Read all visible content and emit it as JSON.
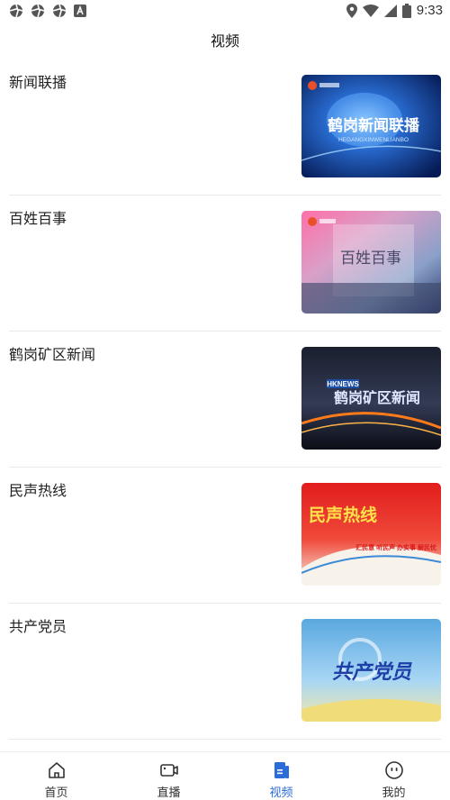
{
  "status_bar": {
    "time": "9:33",
    "left_icons": [
      "aperture-icon",
      "aperture-icon",
      "aperture-icon",
      "a-badge-icon"
    ],
    "right_icons": [
      "location-icon",
      "wifi-icon",
      "signal-icon",
      "battery-icon"
    ]
  },
  "header": {
    "title": "视频"
  },
  "videos": [
    {
      "title": "新闻联播",
      "thumb_text": "鹤岗新闻联播",
      "thumb_sub": "HEGANGXINWENLIANBO"
    },
    {
      "title": "百姓百事",
      "thumb_text": "百姓百事",
      "thumb_sub": ""
    },
    {
      "title": "鹤岗矿区新闻",
      "thumb_text": "鹤岗矿区新闻",
      "thumb_sub": "HKNEWS"
    },
    {
      "title": "民声热线",
      "thumb_text": "民声热线",
      "thumb_sub": "汇民意 听民声 办实事 解民忧"
    },
    {
      "title": "共产党员",
      "thumb_text": "共产党员",
      "thumb_sub": ""
    }
  ],
  "nav": {
    "home": "首页",
    "live": "直播",
    "video": "视频",
    "mine": "我的",
    "active": "video",
    "active_color": "#2b6cd8"
  }
}
